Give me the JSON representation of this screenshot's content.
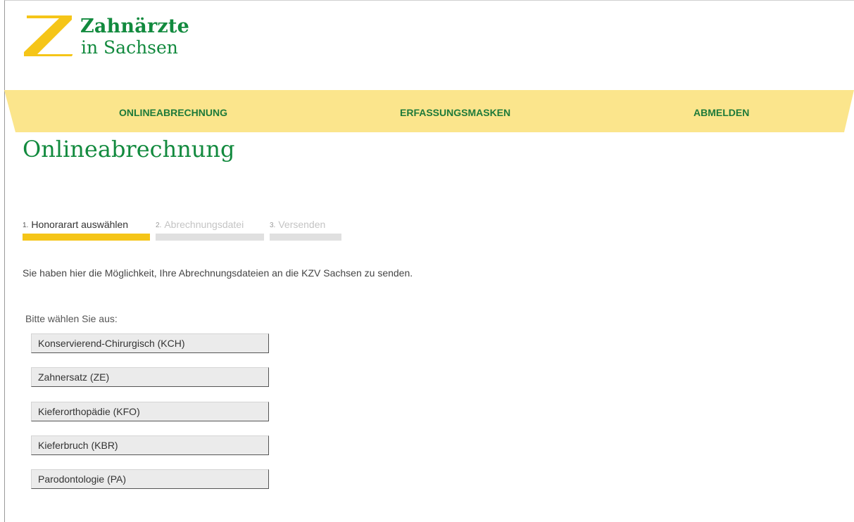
{
  "logo": {
    "line1": "Zahnärzte",
    "line2": "in Sachsen",
    "icon": "z-logo-icon",
    "colors": {
      "yellow": "#f5c518",
      "green": "#128a3e"
    }
  },
  "nav": {
    "items": [
      {
        "label": "ONLINEABRECHNUNG"
      },
      {
        "label": "ERFASSUNGSMASKEN"
      },
      {
        "label": "ABMELDEN"
      }
    ],
    "band_color": "#fbe58c"
  },
  "page": {
    "title": "Onlineabrechnung"
  },
  "steps": [
    {
      "num": "1.",
      "label": "Honorarart auswählen",
      "active": true
    },
    {
      "num": "2.",
      "label": "Abrechnungsdatei",
      "active": false
    },
    {
      "num": "3.",
      "label": "Versenden",
      "active": false
    }
  ],
  "intro": "Sie haben hier die Möglichkeit, Ihre Abrechnungsdateien an die KZV Sachsen zu senden.",
  "choose_label": "Bitte wählen Sie aus:",
  "options": [
    {
      "label": "Konservierend-Chirurgisch (KCH)"
    },
    {
      "label": "Zahnersatz (ZE)"
    },
    {
      "label": "Kieferorthopädie (KFO)"
    },
    {
      "label": "Kieferbruch (KBR)"
    },
    {
      "label": "Parodontologie (PA)"
    }
  ]
}
